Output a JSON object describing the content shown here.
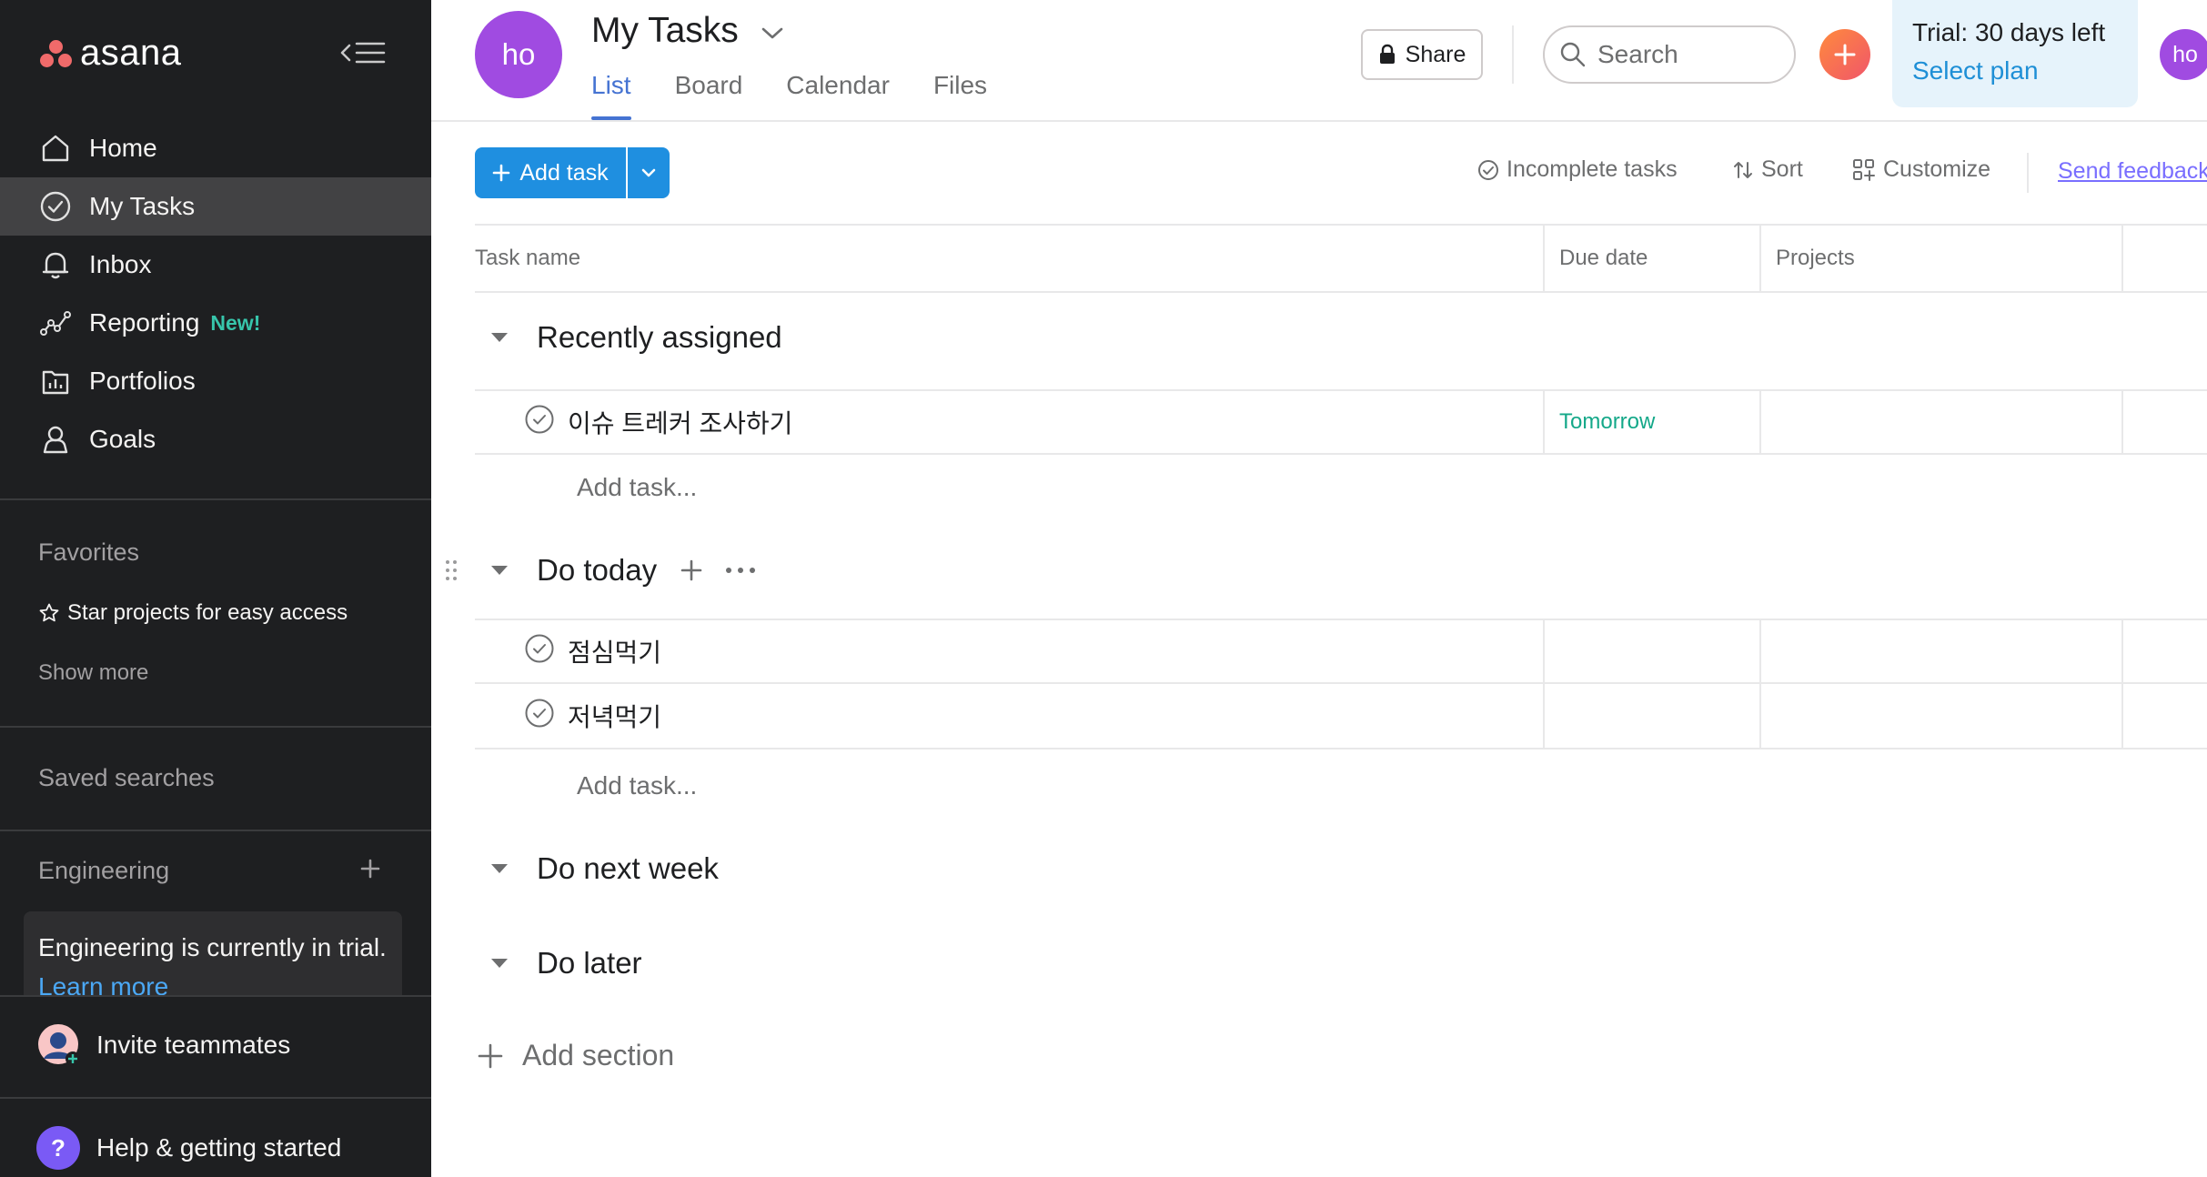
{
  "sidebar": {
    "logo_text": "asana",
    "nav": [
      {
        "label": "Home",
        "icon": "home-icon"
      },
      {
        "label": "My Tasks",
        "icon": "check-circle-icon"
      },
      {
        "label": "Inbox",
        "icon": "bell-icon"
      },
      {
        "label": "Reporting",
        "icon": "chart-line-icon",
        "badge": "New!"
      },
      {
        "label": "Portfolios",
        "icon": "portfolio-icon"
      },
      {
        "label": "Goals",
        "icon": "goals-icon"
      }
    ],
    "favorites_title": "Favorites",
    "favorites_hint": "Star projects for easy access",
    "show_more": "Show more",
    "saved_searches_title": "Saved searches",
    "team_title": "Engineering",
    "trial_text": "Engineering is currently in trial.",
    "learn_more": "Learn more",
    "invite_label": "Invite teammates",
    "help_label": "Help & getting started",
    "help_glyph": "?"
  },
  "header": {
    "avatar_initials": "ho",
    "title": "My Tasks",
    "tabs": [
      {
        "label": "List"
      },
      {
        "label": "Board"
      },
      {
        "label": "Calendar"
      },
      {
        "label": "Files"
      }
    ],
    "share_label": "Share",
    "search_placeholder": "Search",
    "trial_label": "Trial: 30 days left",
    "select_plan": "Select plan",
    "user_initials": "ho"
  },
  "toolbar": {
    "add_task_label": "Add task",
    "incomplete_label": "Incomplete tasks",
    "sort_label": "Sort",
    "customize_label": "Customize",
    "feedback_label": "Send feedback"
  },
  "table": {
    "columns": [
      "Task name",
      "Due date",
      "Projects"
    ],
    "sections": [
      {
        "title": "Recently assigned",
        "tasks": [
          {
            "name": "이슈 트레커 조사하기",
            "due": "Tomorrow"
          }
        ],
        "add_task": "Add task..."
      },
      {
        "title": "Do today",
        "tasks": [
          {
            "name": "점심먹기",
            "due": ""
          },
          {
            "name": "저녁먹기",
            "due": ""
          }
        ],
        "add_task": "Add task..."
      },
      {
        "title": "Do next week",
        "tasks": []
      },
      {
        "title": "Do later",
        "tasks": []
      }
    ],
    "add_section": "Add section"
  },
  "colors": {
    "sidebar_bg": "#1e1f21",
    "active_nav": "#424244",
    "primary_blue": "#1f8fe0",
    "avatar_purple": "#a04be1",
    "due_green": "#14a889",
    "new_badge": "#37c5ab"
  }
}
